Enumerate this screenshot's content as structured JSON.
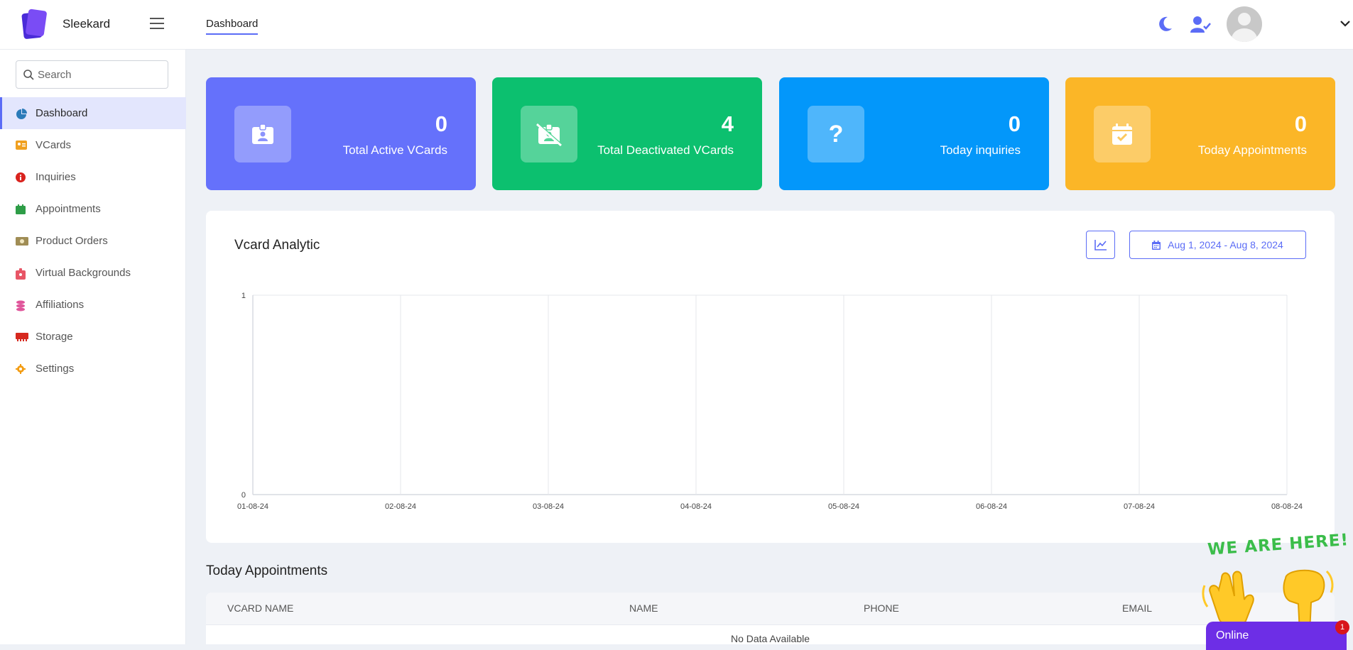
{
  "app": {
    "name": "Sleekard"
  },
  "header": {
    "breadcrumb": "Dashboard"
  },
  "sidebar": {
    "search_placeholder": "Search",
    "items": [
      {
        "label": "Dashboard",
        "icon": "pie-chart-icon",
        "color": "#2b7bb9"
      },
      {
        "label": "VCards",
        "icon": "id-card-icon",
        "color": "#f0a020"
      },
      {
        "label": "Inquiries",
        "icon": "info-circle-icon",
        "color": "#d9231e"
      },
      {
        "label": "Appointments",
        "icon": "calendar-icon",
        "color": "#2e9d47"
      },
      {
        "label": "Product Orders",
        "icon": "money-bill-icon",
        "color": "#a08d55"
      },
      {
        "label": "Virtual Backgrounds",
        "icon": "badge-icon",
        "color": "#e85566"
      },
      {
        "label": "Affiliations",
        "icon": "coins-icon",
        "color": "#e0569b"
      },
      {
        "label": "Storage",
        "icon": "memory-icon",
        "color": "#d6281e"
      },
      {
        "label": "Settings",
        "icon": "gear-icon",
        "color": "#f39c12"
      }
    ]
  },
  "stats": [
    {
      "value": "0",
      "label": "Total Active VCards",
      "color": "#6571fb",
      "icon": "id-badge-icon"
    },
    {
      "value": "4",
      "label": "Total Deactivated VCards",
      "color": "#0cc06f",
      "icon": "id-badge-slash-icon"
    },
    {
      "value": "0",
      "label": "Today inquiries",
      "color": "#0397fa",
      "icon": "question-icon"
    },
    {
      "value": "0",
      "label": "Today Appointments",
      "color": "#fbb627",
      "icon": "calendar-check-icon"
    }
  ],
  "analytics": {
    "title": "Vcard Analytic",
    "date_range": "Aug 1, 2024 - Aug 8, 2024"
  },
  "chart_data": {
    "type": "line",
    "title": "Vcard Analytic",
    "categories": [
      "01-08-24",
      "02-08-24",
      "03-08-24",
      "04-08-24",
      "05-08-24",
      "06-08-24",
      "07-08-24",
      "08-08-24"
    ],
    "series": [],
    "yticks": [
      "1",
      "0"
    ],
    "ylim": [
      0,
      1
    ],
    "grid": true
  },
  "appointments": {
    "title": "Today Appointments",
    "columns": [
      "VCARD NAME",
      "NAME",
      "PHONE",
      "EMAIL"
    ],
    "empty_text": "No Data Available"
  },
  "widget": {
    "banner": "WE ARE HERE!",
    "status": "Online",
    "badge_count": "1"
  }
}
